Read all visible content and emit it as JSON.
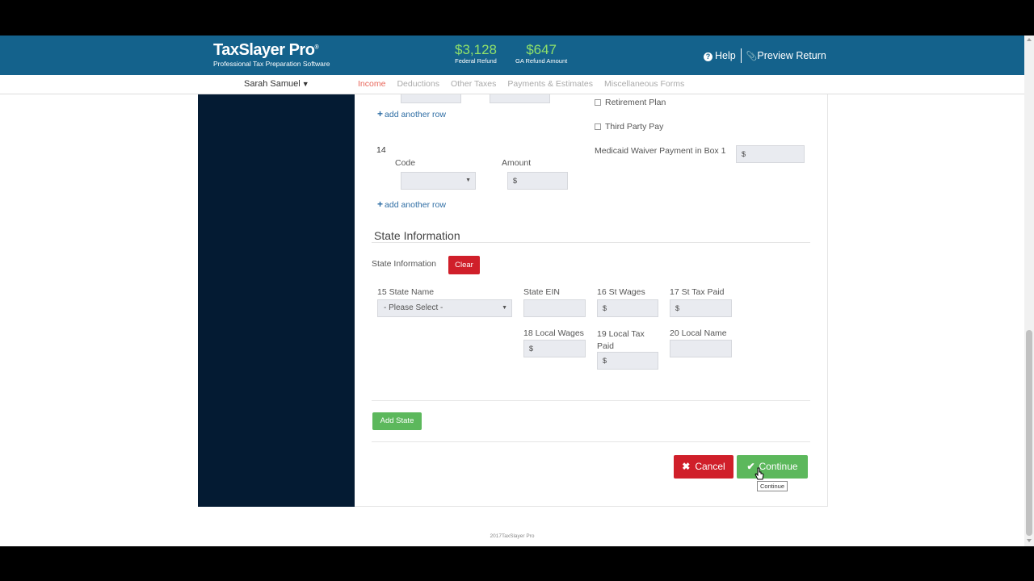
{
  "header": {
    "logo_main": "TaxSlayer Pro",
    "logo_tm": "®",
    "logo_sub": "Professional Tax Preparation Software",
    "federal_amount": "$3,128",
    "federal_label": "Federal Refund",
    "state_amount": "$647",
    "state_label": "GA Refund Amount",
    "help_label": "Help",
    "preview_label": "Preview Return"
  },
  "subnav": {
    "user": "Sarah Samuel",
    "tabs": [
      "Income",
      "Deductions",
      "Other Taxes",
      "Payments & Estimates",
      "Miscellaneous Forms"
    ],
    "active_tab": "Income"
  },
  "form": {
    "add_row_label": "add another row",
    "box14_label": "14",
    "code_label": "Code",
    "amount_label": "Amount",
    "currency_symbol": "$",
    "retirement_plan": "Retirement Plan",
    "third_party_pay": "Third Party Pay",
    "medicaid_label": "Medicaid Waiver Payment in Box 1"
  },
  "state": {
    "section_title": "State Information",
    "sub_label": "State Information",
    "clear_label": "Clear",
    "state_name_label": "15 State Name",
    "state_name_value": "- Please Select -",
    "state_ein_label": "State EIN",
    "st_wages_label": "16 St Wages",
    "st_tax_paid_label": "17 St Tax Paid",
    "local_wages_label": "18 Local Wages",
    "local_tax_paid_label": "19 Local Tax Paid",
    "local_name_label": "20 Local Name",
    "add_state_label": "Add State"
  },
  "actions": {
    "cancel_label": "Cancel",
    "continue_label": "Continue",
    "tooltip": "Continue"
  },
  "footer": {
    "text": "2017TaxSlayer Pro"
  },
  "colors": {
    "header_bg": "#14628c",
    "sidebar_bg": "#041b33",
    "refund_green": "#8fe06a",
    "danger": "#d01f2a",
    "success": "#5cb85c",
    "active_tab": "#e8665a"
  }
}
